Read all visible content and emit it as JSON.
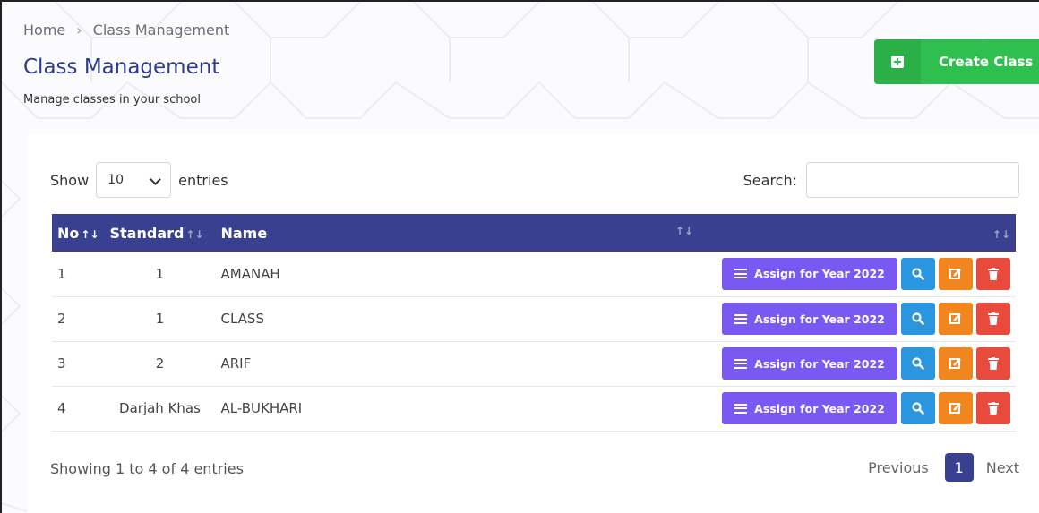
{
  "breadcrumb": {
    "home": "Home",
    "current": "Class Management"
  },
  "page": {
    "title": "Class Management",
    "subtitle": "Manage classes in your school"
  },
  "create_button": {
    "label": "Create Class",
    "icon": "plus-square-icon",
    "color": "#2fbf4f"
  },
  "table_controls": {
    "show_label": "Show",
    "entries_value": "10",
    "entries_label": "entries",
    "search_label": "Search:",
    "search_value": ""
  },
  "table": {
    "header_color": "#38408f",
    "columns": [
      "No",
      "Standard",
      "Name",
      ""
    ],
    "rows": [
      {
        "no": "1",
        "standard": "1",
        "name": "AMANAH",
        "assign_label": "Assign for Year 2022"
      },
      {
        "no": "2",
        "standard": "1",
        "name": "CLASS",
        "assign_label": "Assign for Year 2022"
      },
      {
        "no": "3",
        "standard": "2",
        "name": "ARIF",
        "assign_label": "Assign for Year 2022"
      },
      {
        "no": "4",
        "standard": "Darjah Khas",
        "name": "AL-BUKHARI",
        "assign_label": "Assign for Year 2022"
      }
    ],
    "action_icons": [
      "list-icon",
      "search-icon",
      "edit-icon",
      "trash-icon"
    ],
    "action_colors": {
      "assign": "#7a59f2",
      "view": "#2a96e0",
      "edit": "#f1861f",
      "delete": "#e84a3c"
    }
  },
  "footer": {
    "info": "Showing 1 to 4 of 4 entries",
    "previous": "Previous",
    "current_page": "1",
    "next": "Next"
  }
}
